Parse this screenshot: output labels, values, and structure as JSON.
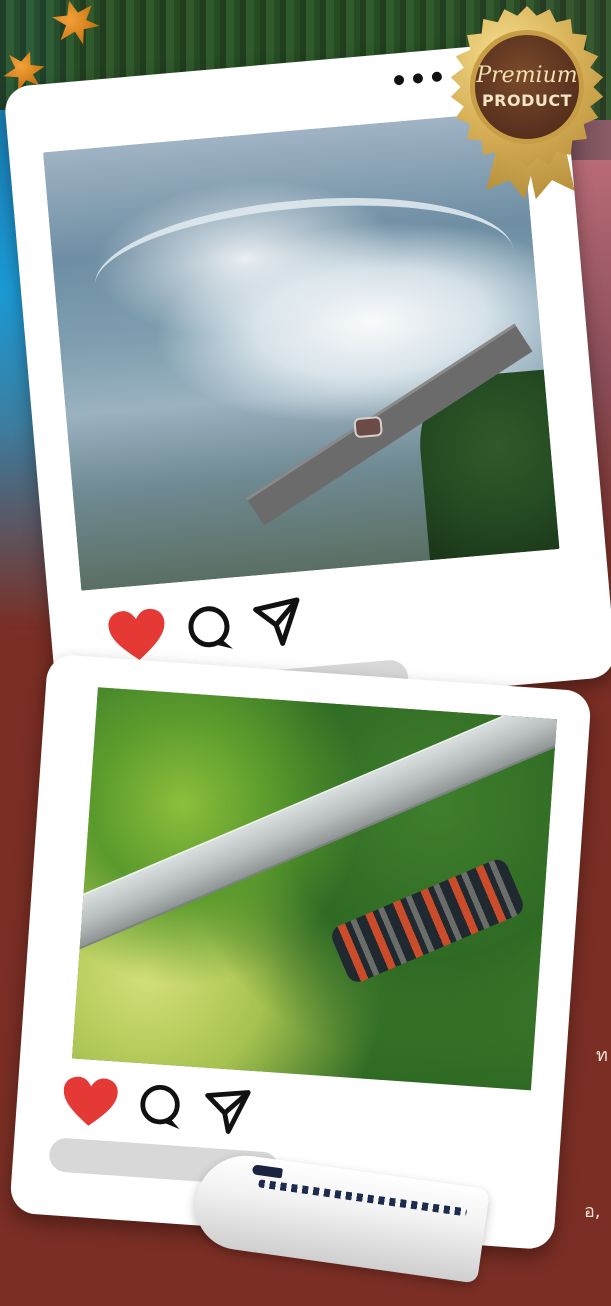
{
  "badge": {
    "script_text": "Premium",
    "label_text": "PRODUCT"
  },
  "posts": [
    {
      "photo": "niagara-falls-photo",
      "icons": [
        "heart-icon",
        "comment-icon",
        "send-icon"
      ],
      "liked": true
    },
    {
      "photo": "suspension-bridge-photo",
      "icons": [
        "heart-icon",
        "comment-icon",
        "send-icon"
      ],
      "liked": true
    }
  ],
  "menu_icon": "more-dots-icon",
  "colors": {
    "background": "#7a2e24",
    "card": "#ffffff",
    "heart": "#e53935",
    "placeholder_bar": "#d8d8d8",
    "badge_gold": "#d9b35a",
    "badge_brown": "#5e3520"
  },
  "background": {
    "cutoff_text_1": "ท",
    "cutoff_text_2": "อ,"
  }
}
